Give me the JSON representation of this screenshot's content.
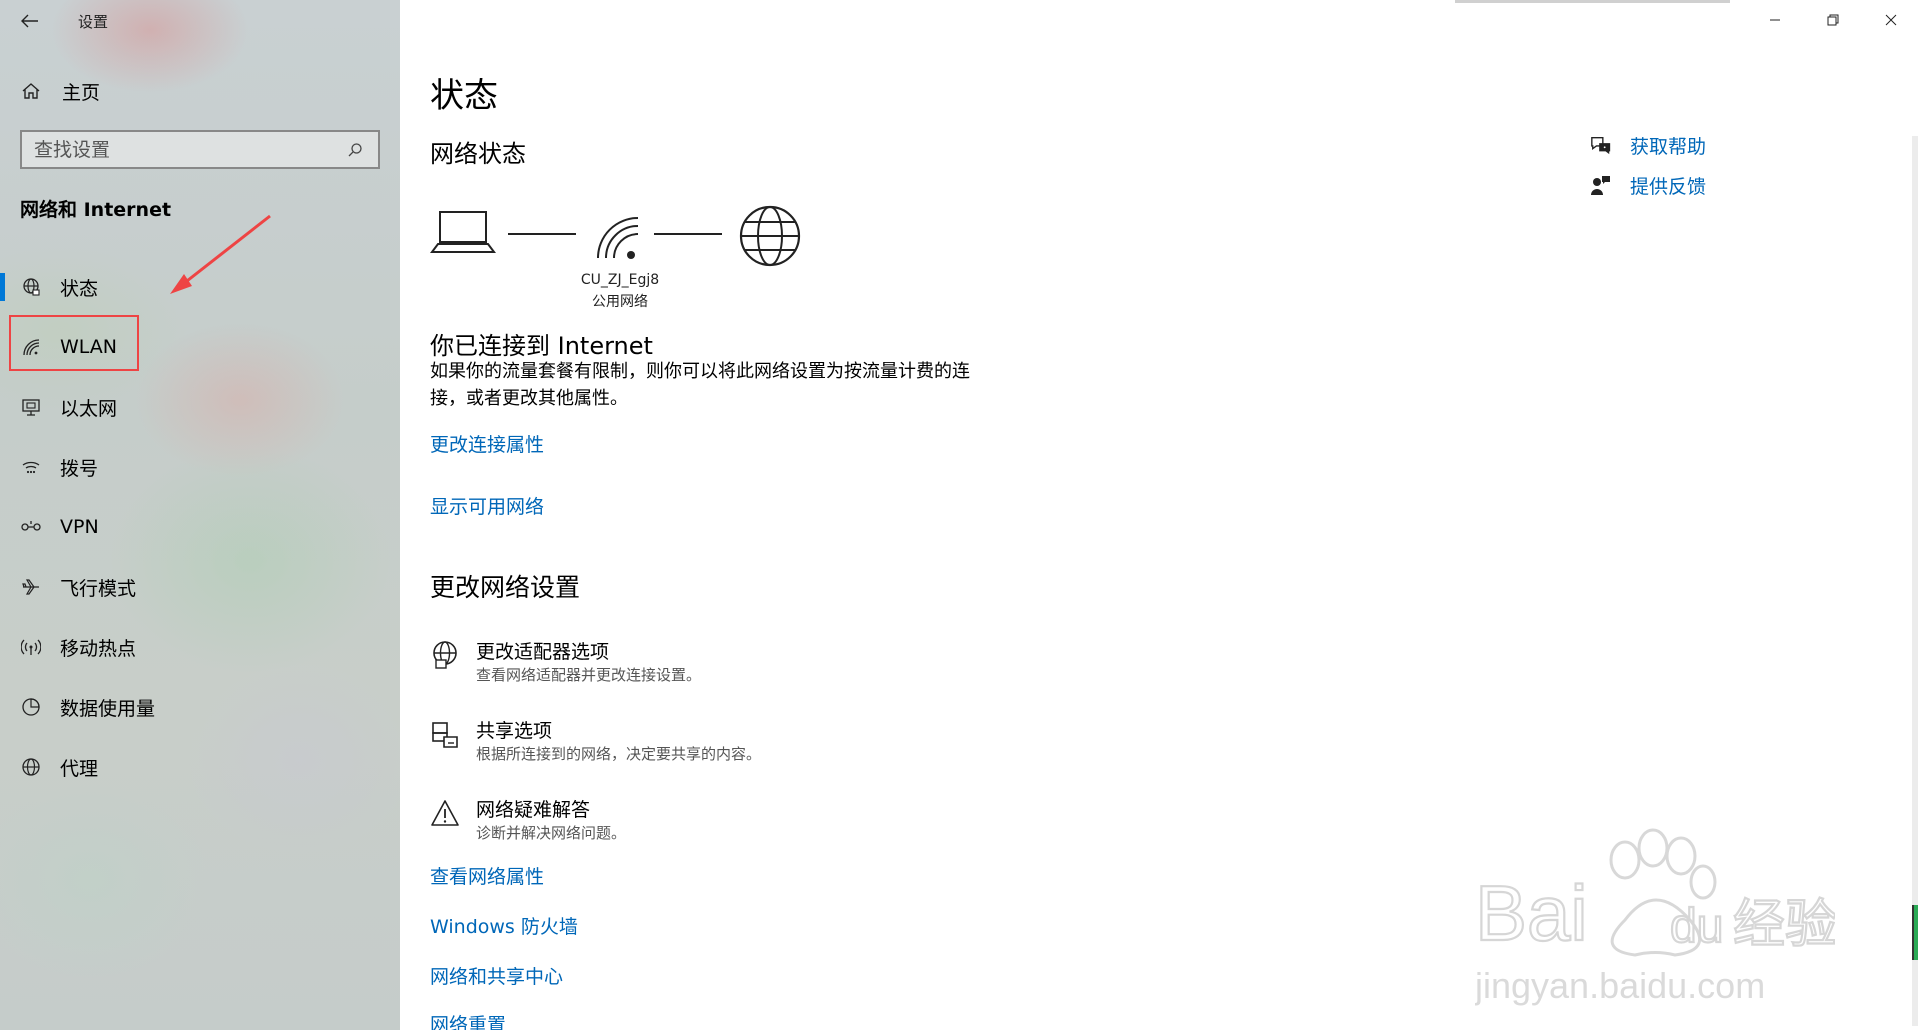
{
  "window": {
    "title": "设置"
  },
  "sidebar": {
    "home_label": "主页",
    "search_placeholder": "查找设置",
    "section_title": "网络和 Internet",
    "items": [
      {
        "label": "状态",
        "icon": "globe-status-icon",
        "active": true
      },
      {
        "label": "WLAN",
        "icon": "wifi-icon",
        "active": false
      },
      {
        "label": "以太网",
        "icon": "ethernet-icon",
        "active": false
      },
      {
        "label": "拨号",
        "icon": "dialup-icon",
        "active": false
      },
      {
        "label": "VPN",
        "icon": "vpn-icon",
        "active": false
      },
      {
        "label": "飞行模式",
        "icon": "airplane-icon",
        "active": false
      },
      {
        "label": "移动热点",
        "icon": "hotspot-icon",
        "active": false
      },
      {
        "label": "数据使用量",
        "icon": "data-usage-icon",
        "active": false
      },
      {
        "label": "代理",
        "icon": "proxy-globe-icon",
        "active": false
      }
    ]
  },
  "main": {
    "title": "状态",
    "network_status_heading": "网络状态",
    "network": {
      "ssid": "CU_ZJ_Egj8",
      "type": "公用网络"
    },
    "connected_title": "你已连接到 Internet",
    "connected_desc": "如果你的流量套餐有限制，则你可以将此网络设置为按流量计费的连接，或者更改其他属性。",
    "links_top": [
      "更改连接属性",
      "显示可用网络"
    ],
    "change_settings_heading": "更改网络设置",
    "settings": [
      {
        "title": "更改适配器选项",
        "desc": "查看网络适配器并更改连接设置。",
        "icon": "adapter-icon"
      },
      {
        "title": "共享选项",
        "desc": "根据所连接到的网络，决定要共享的内容。",
        "icon": "sharing-icon"
      },
      {
        "title": "网络疑难解答",
        "desc": "诊断并解决网络问题。",
        "icon": "warning-icon"
      }
    ],
    "links_bottom": [
      "查看网络属性",
      "Windows 防火墙",
      "网络和共享中心",
      "网络重置"
    ]
  },
  "help": {
    "get_help": "获取帮助",
    "feedback": "提供反馈"
  },
  "colors": {
    "accent": "#0078d7",
    "link": "#0067b8",
    "highlight_border": "#e44444"
  }
}
